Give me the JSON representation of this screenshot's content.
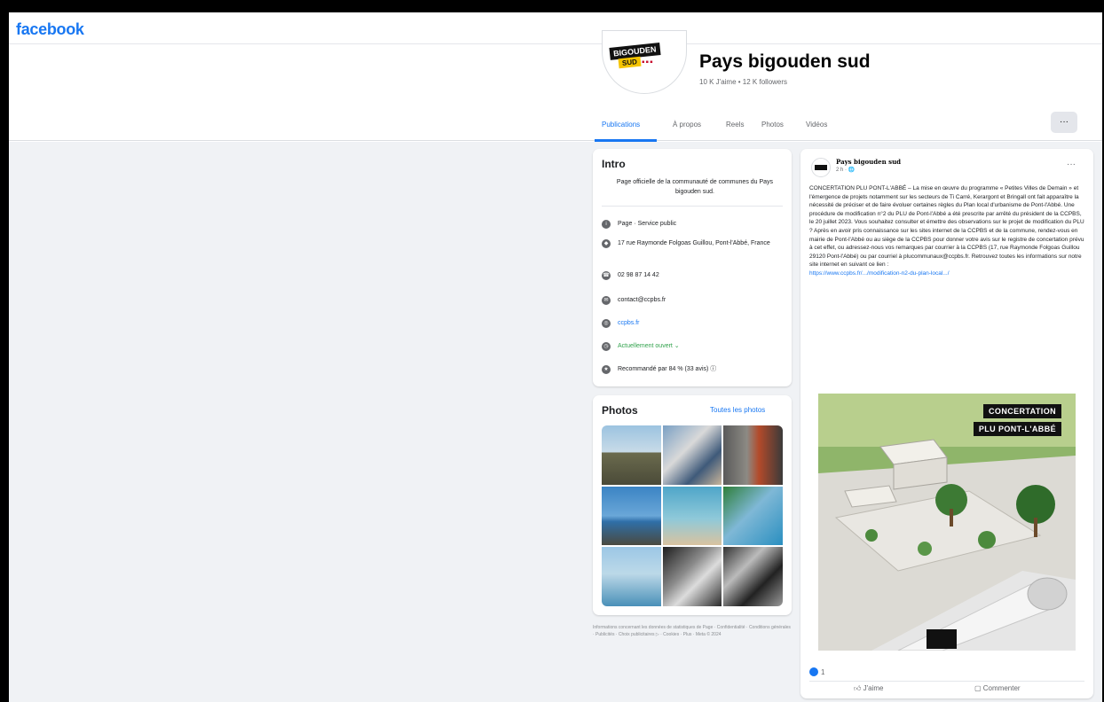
{
  "brand": "facebook",
  "page": {
    "logo_text": "BIGOUDEN",
    "logo_sub": "SUD",
    "name": "Pays bigouden sud",
    "stats": "10 K J'aime • 12 K followers"
  },
  "tabs": [
    "Publications",
    "À propos",
    "Reels",
    "Photos",
    "Vidéos"
  ],
  "more_button": "···",
  "intro": {
    "title": "Intro",
    "description": "Page officielle de la communauté de communes du Pays bigouden sud.",
    "rows": [
      {
        "icon": "info-icon",
        "text": "Page · Service public"
      },
      {
        "icon": "location-icon",
        "text": "17 rue Raymonde Folgoas Guillou, Pont-l'Abbé, France"
      },
      {
        "icon": "phone-icon",
        "text": "02 98 87 14 42"
      },
      {
        "icon": "email-icon",
        "text": "contact@ccpbs.fr"
      },
      {
        "icon": "web-icon",
        "text": "ccpbs.fr"
      },
      {
        "icon": "clock-icon",
        "text": "Actuellement ouvert ⌄"
      },
      {
        "icon": "star-icon",
        "text": "Recommandé par 84 % (33 avis) ⓘ"
      }
    ]
  },
  "photos": {
    "title": "Photos",
    "see_all": "Toutes les photos"
  },
  "footer": "Informations concernant les données de statistiques de Page · Confidentialité · Conditions générales · Publicités · Choix publicitaires ▷ · Cookies · Plus · Meta © 2024",
  "post": {
    "author": "Pays bigouden sud",
    "time": "2 h · 🌐",
    "menu": "···",
    "text": "CONCERTATION PLU PONT-L'ABBÉ – La mise en œuvre du programme « Petites Villes de Demain » et l'émergence de projets notamment sur les secteurs de Ti Carré, Kerargont et Bringall ont fait apparaître la nécessité de préciser et de faire évoluer certaines règles du Plan local d'urbanisme de Pont-l'Abbé. Une procédure de modification n°2 du PLU de Pont-l'Abbé a été prescrite par arrêté du président de la CCPBS, le 20 juillet 2023. Vous souhaitez consulter et émettre des observations sur le projet de modification du PLU ? Après en avoir pris connaissance sur les sites internet de la CCPBS et de la commune, rendez-vous en mairie de Pont-l'Abbé ou au siège de la CCPBS pour donner votre avis sur le registre de concertation prévu à cet effet, ou adressez-nous vos remarques par courrier à la CCPBS (17, rue Raymonde Folgoas Guillou 29120 Pont-l'Abbé) ou par courriel à plucommunaux@ccpbs.fr. Retrouvez toutes les informations sur notre site internet en suivant ce lien :",
    "link": "https://www.ccpbs.fr/.../modification-n2-du-plan-local.../",
    "image_label_1": "CONCERTATION",
    "image_label_2": "PLU PONT-L'ABBÉ",
    "reaction_count": "1",
    "like_label": "J'aime",
    "comment_label": "Commenter"
  },
  "colors": {
    "brand_blue": "#1877f2",
    "background": "#f0f2f5",
    "open_green": "#31a24c"
  }
}
